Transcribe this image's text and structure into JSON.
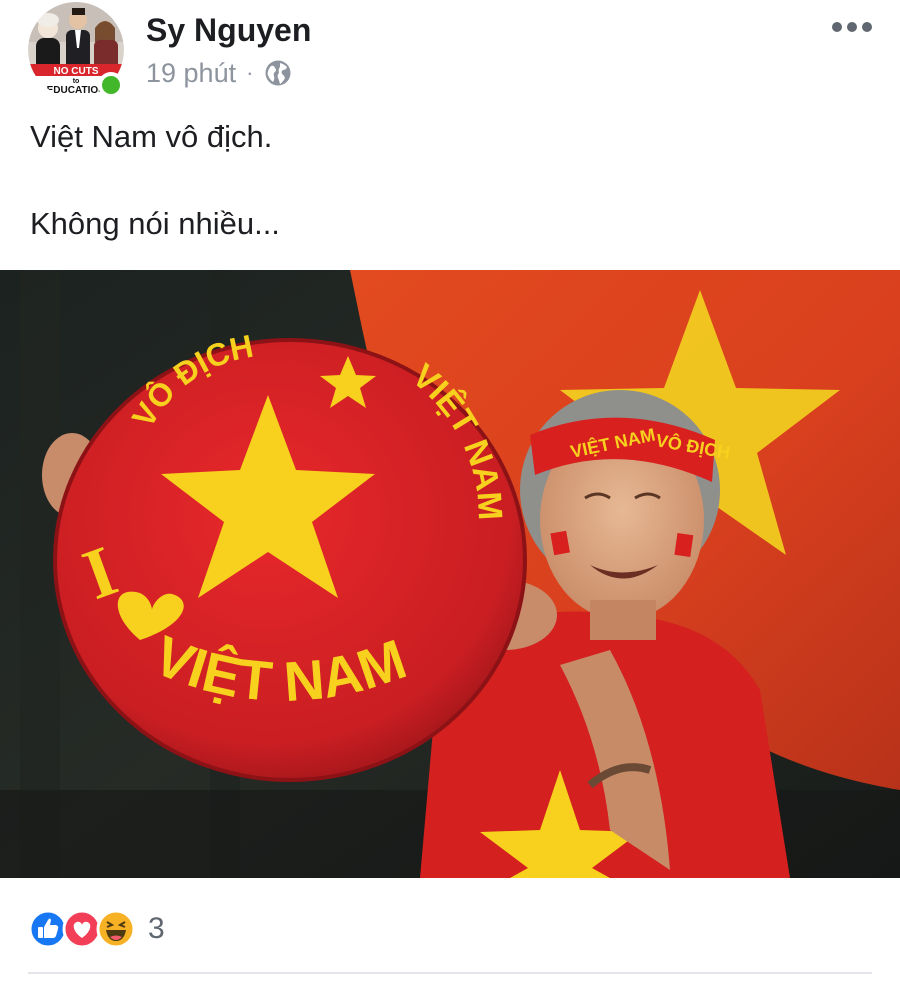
{
  "post": {
    "author": "Sy Nguyen",
    "time": "19 phút",
    "separator": "·",
    "privacy_icon": "globe-icon",
    "more_icon": "more-horizontal-icon",
    "lines": [
      "Việt Nam vô địch.",
      "Không nói nhiều..."
    ],
    "avatar": {
      "sign_text_1": "NO CUTS",
      "sign_text_2": "to",
      "sign_text_3": "EDUCATION",
      "online": true
    }
  },
  "photo": {
    "hat_text_top": "VÔ ĐỊCH",
    "hat_text_side": "VIỆT NAM",
    "hat_text_i": "I",
    "hat_text_bottom": "VIỆT NAM",
    "headband_text_1": "VIỆT NAM",
    "headband_text_2": "VÔ ĐỊCH"
  },
  "reactions": {
    "icons": [
      "like-icon",
      "love-icon",
      "haha-icon"
    ],
    "count": "3"
  },
  "colors": {
    "text": "#1c1e21",
    "meta": "#8d949e",
    "online": "#42b72a",
    "like": "#1877f2",
    "love": "#f33e58",
    "haha": "#f7b125",
    "flag_red": "#da251d",
    "flag_star": "#ffcd00"
  }
}
